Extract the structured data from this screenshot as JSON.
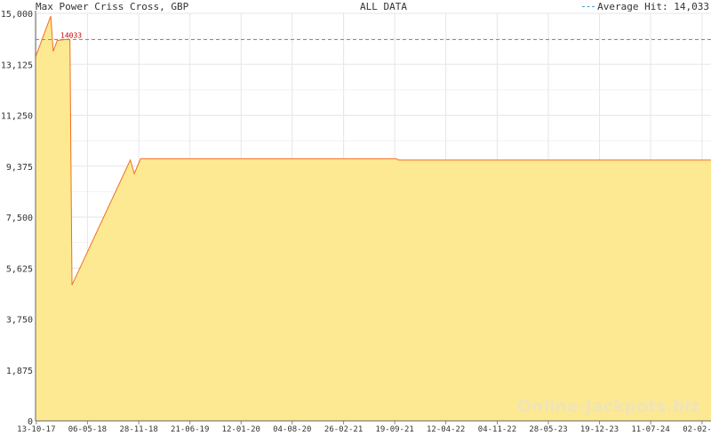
{
  "header": {
    "title": "Max Power Criss Cross, GBP",
    "center": "ALL DATA",
    "avg_text": "Average Hit: 14,033"
  },
  "watermark": "Online-Jackpots.biz",
  "colors": {
    "fill": "#fde992",
    "line": "#f07020",
    "avg_line": "#4a9fc8",
    "grid": "#e6e6e6",
    "label_red": "#cc0000"
  },
  "chart_data": {
    "type": "area",
    "title": "Max Power Criss Cross, GBP",
    "ylim": [
      0,
      15000
    ],
    "yticks": [
      "0",
      "1,875",
      "3,750",
      "5,625",
      "7,500",
      "9,375",
      "11,250",
      "13,125",
      "15,000"
    ],
    "ytick_values": [
      0,
      1875,
      3750,
      5625,
      7500,
      9375,
      11250,
      13125,
      15000
    ],
    "xticks": [
      "13-10-17",
      "06-05-18",
      "28-11-18",
      "21-06-19",
      "12-01-20",
      "04-08-20",
      "26-02-21",
      "19-09-21",
      "12-04-22",
      "04-11-22",
      "28-05-23",
      "19-12-23",
      "11-07-24",
      "02-02-25"
    ],
    "xtick_dates": [
      "2017-10-13",
      "2018-05-06",
      "2018-11-28",
      "2019-06-21",
      "2020-01-12",
      "2020-08-04",
      "2021-02-26",
      "2021-09-19",
      "2022-04-12",
      "2022-11-04",
      "2023-05-28",
      "2023-12-19",
      "2024-07-11",
      "2025-02-02"
    ],
    "xlim": [
      "2017-10-10",
      "2025-03-10"
    ],
    "series": [
      {
        "points": [
          [
            "2017-10-10",
            13400
          ],
          [
            "2017-12-10",
            14900
          ],
          [
            "2017-12-20",
            13600
          ],
          [
            "2018-01-05",
            14000
          ],
          [
            "2018-02-20",
            14050
          ],
          [
            "2018-02-25",
            14000
          ],
          [
            "2018-03-05",
            5000
          ],
          [
            "2018-10-25",
            9600
          ],
          [
            "2018-11-10",
            9100
          ],
          [
            "2018-12-05",
            9650
          ],
          [
            "2021-09-25",
            9650
          ],
          [
            "2021-10-05",
            9600
          ],
          [
            "2025-03-10",
            9600
          ]
        ]
      }
    ],
    "average": {
      "value": 14033,
      "label": "14033"
    },
    "grid": true
  }
}
